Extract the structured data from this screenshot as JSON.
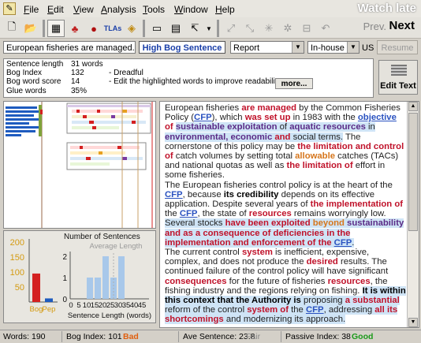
{
  "menu": {
    "items": [
      "File",
      "Edit",
      "View",
      "Analysis",
      "Tools",
      "Window",
      "Help"
    ],
    "overlay_text": "Watch late"
  },
  "toolbar": {
    "prev_label": "Prev.",
    "next_label": "Next"
  },
  "controls": {
    "sentence_preview": "European fisheries are managed...",
    "mode_button": "High Bog Sentence",
    "doc_type": "Report",
    "audience": "In-house",
    "locale": "US",
    "resume_label": "Resume",
    "edit_text_label": "Edit Text"
  },
  "stats": {
    "rows": [
      {
        "label": "Sentence length",
        "value": "31 words",
        "desc": ""
      },
      {
        "label": "Bog Index",
        "value": "132",
        "desc": "- Dreadful"
      },
      {
        "label": "Bog word score",
        "value": "14",
        "desc": "- Edit the highlighted words to improve readability."
      },
      {
        "label": "Glue words",
        "value": "35%",
        "desc": ""
      }
    ],
    "more_label": "more..."
  },
  "graphs": {
    "left_chart": {
      "y_ticks": [
        "200",
        "150",
        "100",
        "50"
      ],
      "x_labels": [
        "Bog",
        "Pep"
      ],
      "values": [
        95,
        12
      ],
      "ylim": [
        0,
        200
      ]
    },
    "right_chart": {
      "title": "Number of Sentences",
      "avg_label": "Average Length",
      "xlabel": "Sentence Length (words)",
      "x_ticks": [
        "0",
        "5",
        "10",
        "15",
        "20",
        "25",
        "30",
        "35",
        "40",
        "45"
      ],
      "y_ticks": [
        "2",
        "1",
        "0"
      ],
      "counts": [
        0,
        0,
        1,
        1,
        2,
        1,
        2,
        0,
        0,
        0
      ],
      "ylim": [
        0,
        2
      ]
    }
  },
  "text": {
    "paragraphs": [
      [
        {
          "t": "European fisheries "
        },
        {
          "t": "are managed",
          "c": "hl-red"
        },
        {
          "t": " by the Common Fisheries Policy ("
        },
        {
          "t": "CFP",
          "c": "hl-link"
        },
        {
          "t": "), which "
        },
        {
          "t": "was set up",
          "c": "hl-red"
        },
        {
          "t": " in 1983 with the "
        },
        {
          "t": "objective",
          "c": "hl-link"
        },
        {
          "t": " "
        },
        {
          "t": "of ",
          "c": "hl-red"
        },
        {
          "t": "sustainable exploitation",
          "c": "hl-purple hl-blue"
        },
        {
          "t": " of ",
          "c": "hl-blue"
        },
        {
          "t": "aquatic resources",
          "c": "hl-purple hl-blue"
        },
        {
          "t": " in ",
          "c": "hl-blue"
        },
        {
          "t": "environmental, economic",
          "c": "hl-purple hl-blue"
        },
        {
          "t": " and ",
          "c": "hl-red hl-blue"
        },
        {
          "t": "social terms.",
          "c": "hl-blue"
        },
        {
          "t": " The cornerstone of this policy may be "
        },
        {
          "t": "the limitation and control of",
          "c": "hl-red"
        },
        {
          "t": " catch volumes by setting total "
        },
        {
          "t": "allowable",
          "c": "hl-orange"
        },
        {
          "t": " catches (TACs) and national quotas as well as "
        },
        {
          "t": "the limitation of",
          "c": "hl-red"
        },
        {
          "t": " effort in some fisheries."
        }
      ],
      [
        {
          "t": "The European fisheries control policy is at the heart of the "
        },
        {
          "t": "CFP",
          "c": "hl-link"
        },
        {
          "t": ", because "
        },
        {
          "t": "its credibility",
          "c": "hl-dark"
        },
        {
          "t": " depends on its effective application. Despite several years of "
        },
        {
          "t": "the implementation of",
          "c": "hl-red"
        },
        {
          "t": " the "
        },
        {
          "t": "CFP",
          "c": "hl-link"
        },
        {
          "t": ", the state of "
        },
        {
          "t": "resources",
          "c": "hl-red"
        },
        {
          "t": " remains worryingly low. "
        },
        {
          "t": "Several stocks ",
          "c": "hl-blue"
        },
        {
          "t": "have been exploited",
          "c": "hl-red hl-blue"
        },
        {
          "t": " ",
          "c": "hl-blue"
        },
        {
          "t": "beyond",
          "c": "hl-orange hl-blue"
        },
        {
          "t": " ",
          "c": "hl-blue"
        },
        {
          "t": "sustainability",
          "c": "hl-purple hl-blue"
        },
        {
          "t": " and as a consequence of deficiencies in the ",
          "c": "hl-red hl-blue"
        },
        {
          "t": "implementation and enforcement of the ",
          "c": "hl-red hl-blue"
        },
        {
          "t": "CFP",
          "c": "hl-link hl-blue"
        },
        {
          "t": ".",
          "c": "hl-blue"
        }
      ],
      [
        {
          "t": "The current control "
        },
        {
          "t": "system",
          "c": "hl-red"
        },
        {
          "t": " is inefficient, expensive, complex, and does not produce the "
        },
        {
          "t": "desired",
          "c": "hl-red"
        },
        {
          "t": " results. The continued failure of the control policy will have significant "
        },
        {
          "t": "consequences",
          "c": "hl-red"
        },
        {
          "t": " for the future of fisheries "
        },
        {
          "t": "resources",
          "c": "hl-red"
        },
        {
          "t": ", the fishing industry and the regions relying on fishing. "
        },
        {
          "t": "It is within this context that the Authority is",
          "c": "hl-dark hl-blue"
        },
        {
          "t": " proposing ",
          "c": "hl-blue"
        },
        {
          "t": "a substantial",
          "c": "hl-red hl-blue"
        },
        {
          "t": " reform of the control ",
          "c": "hl-blue"
        },
        {
          "t": "system of",
          "c": "hl-red hl-blue"
        },
        {
          "t": " the ",
          "c": "hl-blue"
        },
        {
          "t": "CFP",
          "c": "hl-link hl-blue"
        },
        {
          "t": ", addressing ",
          "c": "hl-blue"
        },
        {
          "t": "all its shortcomings",
          "c": "hl-red hl-blue"
        },
        {
          "t": " and modernizing its approach.",
          "c": "hl-blue"
        }
      ]
    ]
  },
  "status": {
    "words": "Words: 190",
    "bog_index": "Bog Index: 101",
    "bog_rating": "Bad",
    "ave_sentence": "Ave Sentence: 23.8",
    "ave_rating": "Fair",
    "passive_index": "Passive Index: 38",
    "passive_rating": "Good"
  },
  "colors": {
    "bad": "#e06010",
    "fair": "#888888",
    "good": "#1a9a1a",
    "bar_red": "#d42020",
    "bar_blue": "#1e5bbf",
    "bar_light_blue": "#a8c8ea"
  }
}
